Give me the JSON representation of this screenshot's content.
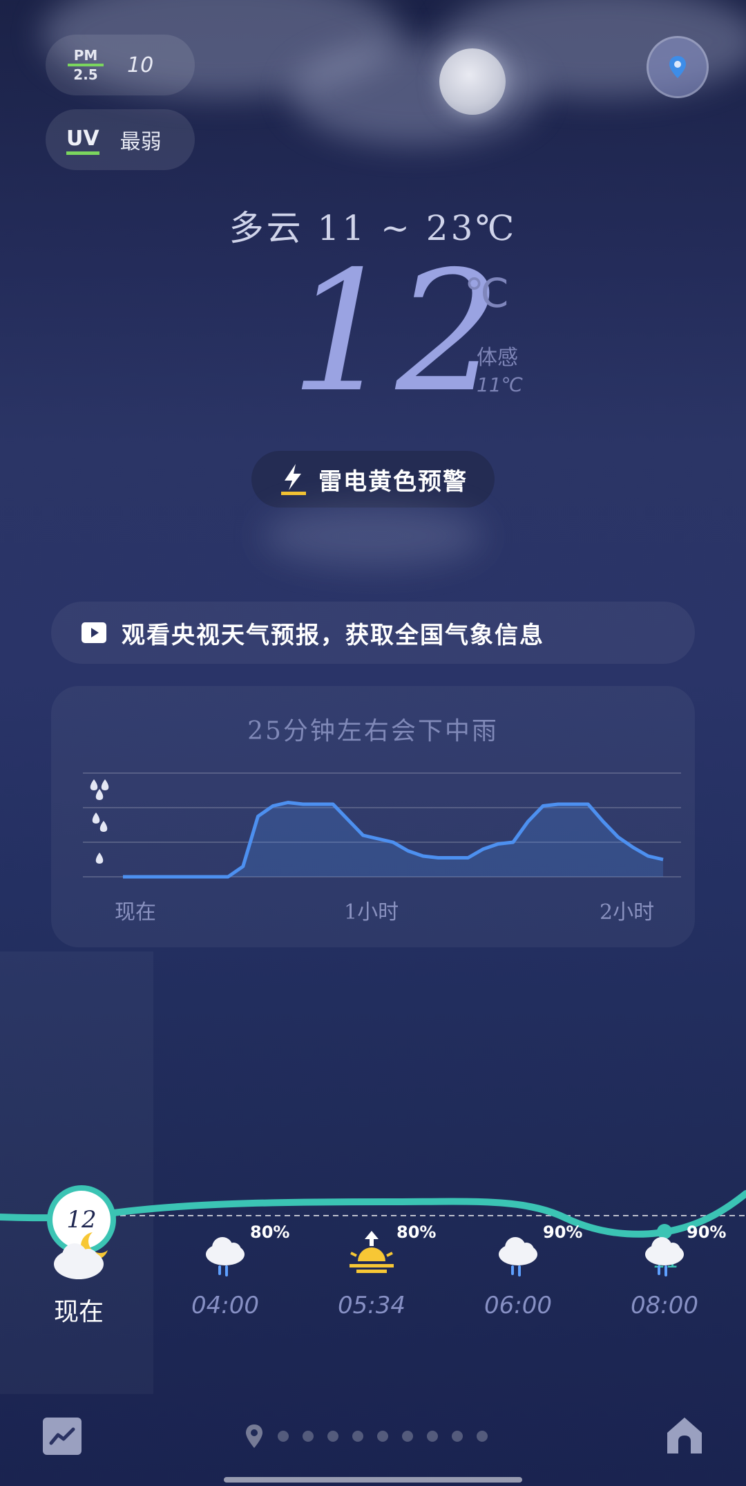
{
  "air": {
    "pm_label_top": "PM",
    "pm_label_bottom": "2.5",
    "pm_value": "10",
    "uv_label": "UV",
    "uv_value": "最弱"
  },
  "current": {
    "summary": "多云 11 ~ 23℃",
    "temperature": "12",
    "unit": "℃",
    "feels_like_label": "体感",
    "feels_like_value": "11℃"
  },
  "alert": {
    "icon": "lightning-icon",
    "text": "雷电黄色预警",
    "color": "#f2c230"
  },
  "video_banner": {
    "icon": "play-icon",
    "text": "观看央视天气预报，获取全国气象信息"
  },
  "rain_forecast": {
    "title": "25分钟左右会下中雨",
    "x_labels": [
      "现在",
      "1小时",
      "2小时"
    ]
  },
  "chart_data": {
    "type": "area",
    "title": "25分钟左右会下中雨",
    "x_labels": [
      "现在",
      "1小时",
      "2小时"
    ],
    "y_labels": [
      "light-rain-icon",
      "moderate-rain-icon",
      "heavy-rain-icon"
    ],
    "ylim": [
      0,
      3
    ],
    "grid": true,
    "color": "#4d90f0",
    "values": [
      0,
      0,
      0,
      0,
      0,
      0,
      0,
      0,
      0.3,
      1.75,
      2.05,
      2.15,
      2.1,
      2.1,
      2.1,
      1.65,
      1.2,
      1.1,
      1.0,
      0.75,
      0.6,
      0.55,
      0.55,
      0.55,
      0.8,
      0.95,
      1.0,
      1.6,
      2.05,
      2.1,
      2.1,
      2.1,
      1.6,
      1.15,
      0.85,
      0.6,
      0.5
    ]
  },
  "hourly": {
    "current_temp": "12",
    "low_temp": "11",
    "items": [
      {
        "icon": "cloudy-night-icon",
        "time": "现在",
        "pct": ""
      },
      {
        "icon": "rain-cloud-icon",
        "time": "04:00",
        "pct": "80%"
      },
      {
        "icon": "sunrise-icon",
        "time": "05:34",
        "pct": "80%"
      },
      {
        "icon": "rain-cloud-icon",
        "time": "06:00",
        "pct": "90%"
      },
      {
        "icon": "rain-cloud-icon",
        "time": "08:00",
        "pct": "90%"
      }
    ]
  },
  "colors": {
    "accent": "#3bc4b4",
    "rain": "#4d90f0",
    "bg": "#242c5a"
  },
  "footer": {
    "left_icon": "trend-chart-icon",
    "right_icon": "home-icon",
    "page_count": 9
  }
}
